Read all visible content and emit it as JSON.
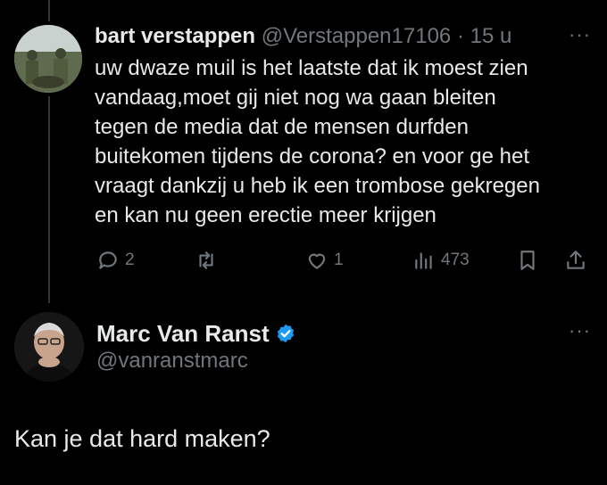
{
  "reply": {
    "name": "bart verstappen",
    "handle": "@Verstappen17106",
    "separator": "·",
    "age": "15 u",
    "more": "···",
    "lines": [
      "uw dwaze muil is het laatste dat ik moest zien",
      "vandaag,moet gij niet nog wa gaan bleiten",
      "tegen de media dat de mensen durfden",
      "buitekomen tijdens de corona? en voor ge het",
      "vraagt dankzij u heb ik een trombose gekregen",
      "en kan nu geen erectie meer krijgen"
    ],
    "stats": {
      "replies": "2",
      "likes": "1",
      "views": "473"
    }
  },
  "main_tweet": {
    "name": "Marc Van Ranst",
    "handle": "@vanranstmarc",
    "more": "···",
    "text": "Kan je dat hard maken?"
  },
  "colors": {
    "background": "#000000",
    "text": "#e7e9ea",
    "muted": "#71767b",
    "verified": "#1d9bf0"
  }
}
